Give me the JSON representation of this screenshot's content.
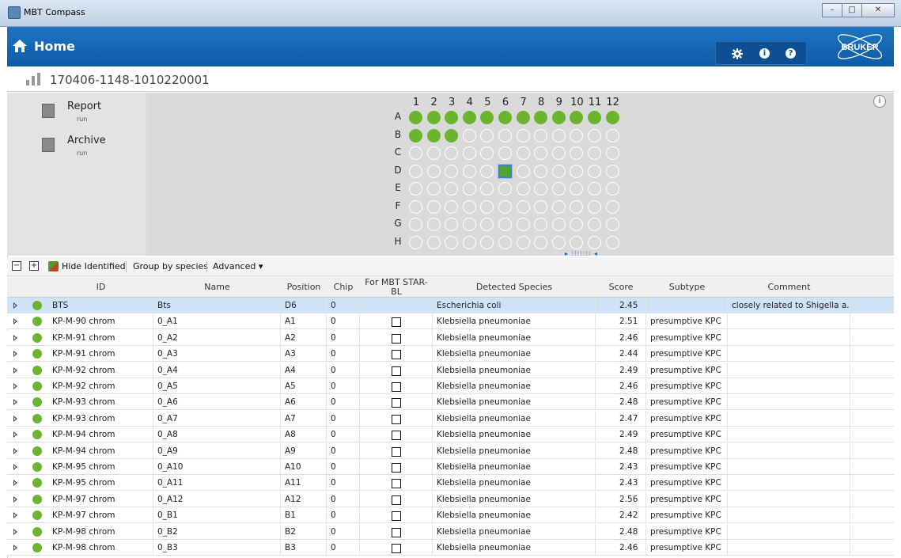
{
  "window": {
    "title": "MBT Compass",
    "controls": [
      "–",
      "□",
      "✕"
    ]
  },
  "header": {
    "home_label": "Home",
    "brand": "BRUKER"
  },
  "run": {
    "id": "170406-1148-1010220001"
  },
  "actions": [
    {
      "label": "Report",
      "sub": "run",
      "icon": "report-icon"
    },
    {
      "label": "Archive",
      "sub": "run",
      "icon": "archive-icon"
    }
  ],
  "plate": {
    "columns": [
      "1",
      "2",
      "3",
      "4",
      "5",
      "6",
      "7",
      "8",
      "9",
      "10",
      "11",
      "12"
    ],
    "rows": [
      "A",
      "B",
      "C",
      "D",
      "E",
      "F",
      "G",
      "H"
    ],
    "filled": {
      "A": [
        1,
        2,
        3,
        4,
        5,
        6,
        7,
        8,
        9,
        10,
        11,
        12
      ],
      "B": [
        1,
        2,
        3
      ]
    },
    "selected": {
      "row": "D",
      "col": 6
    },
    "info": "i",
    "scroll_indicator": "▸ ⁝⁝⁝⁝⁝⁝⁝ ◂"
  },
  "toolbar": {
    "collapse": "−",
    "expand": "+",
    "hide_identified": "Hide Identified",
    "group_by": "Group by species",
    "advanced": "Advanced ▾"
  },
  "columns": {
    "id": "ID",
    "name": "Name",
    "position": "Position",
    "chip": "Chip",
    "star": "For MBT STAR-BL",
    "species": "Detected Species",
    "score": "Score",
    "subtype": "Subtype",
    "comment": "Comment"
  },
  "rows": [
    {
      "id": "BTS",
      "name": "Bts",
      "position": "D6",
      "chip": "0",
      "species": "Escherichia coli",
      "score": "2.45",
      "subtype": "",
      "comment": "closely related to Shigella a...",
      "selected": true,
      "checkbox": false
    },
    {
      "id": "KP-M-90 chrom",
      "name": "0_A1",
      "position": "A1",
      "chip": "0",
      "species": "Klebsiella pneumoniae",
      "score": "2.51",
      "subtype": "presumptive KPC",
      "comment": "",
      "checkbox": true
    },
    {
      "id": "KP-M-91 chrom",
      "name": "0_A2",
      "position": "A2",
      "chip": "0",
      "species": "Klebsiella pneumoniae",
      "score": "2.46",
      "subtype": "presumptive KPC",
      "comment": "",
      "checkbox": true
    },
    {
      "id": "KP-M-91 chrom",
      "name": "0_A3",
      "position": "A3",
      "chip": "0",
      "species": "Klebsiella pneumoniae",
      "score": "2.44",
      "subtype": "presumptive KPC",
      "comment": "",
      "checkbox": true
    },
    {
      "id": "KP-M-92 chrom",
      "name": "0_A4",
      "position": "A4",
      "chip": "0",
      "species": "Klebsiella pneumoniae",
      "score": "2.49",
      "subtype": "presumptive KPC",
      "comment": "",
      "checkbox": true
    },
    {
      "id": "KP-M-92 chrom",
      "name": "0_A5",
      "position": "A5",
      "chip": "0",
      "species": "Klebsiella pneumoniae",
      "score": "2.46",
      "subtype": "presumptive KPC",
      "comment": "",
      "checkbox": true
    },
    {
      "id": "KP-M-93 chrom",
      "name": "0_A6",
      "position": "A6",
      "chip": "0",
      "species": "Klebsiella pneumoniae",
      "score": "2.48",
      "subtype": "presumptive KPC",
      "comment": "",
      "checkbox": true
    },
    {
      "id": "KP-M-93 chrom",
      "name": "0_A7",
      "position": "A7",
      "chip": "0",
      "species": "Klebsiella pneumoniae",
      "score": "2.47",
      "subtype": "presumptive KPC",
      "comment": "",
      "checkbox": true
    },
    {
      "id": "KP-M-94 chrom",
      "name": "0_A8",
      "position": "A8",
      "chip": "0",
      "species": "Klebsiella pneumoniae",
      "score": "2.49",
      "subtype": "presumptive KPC",
      "comment": "",
      "checkbox": true
    },
    {
      "id": "KP-M-94 chrom",
      "name": "0_A9",
      "position": "A9",
      "chip": "0",
      "species": "Klebsiella pneumoniae",
      "score": "2.48",
      "subtype": "presumptive KPC",
      "comment": "",
      "checkbox": true
    },
    {
      "id": "KP-M-95 chrom",
      "name": "0_A10",
      "position": "A10",
      "chip": "0",
      "species": "Klebsiella pneumoniae",
      "score": "2.43",
      "subtype": "presumptive KPC",
      "comment": "",
      "checkbox": true
    },
    {
      "id": "KP-M-95 chrom",
      "name": "0_A11",
      "position": "A11",
      "chip": "0",
      "species": "Klebsiella pneumoniae",
      "score": "2.43",
      "subtype": "presumptive KPC",
      "comment": "",
      "checkbox": true
    },
    {
      "id": "KP-M-97 chrom",
      "name": "0_A12",
      "position": "A12",
      "chip": "0",
      "species": "Klebsiella pneumoniae",
      "score": "2.56",
      "subtype": "presumptive KPC",
      "comment": "",
      "checkbox": true
    },
    {
      "id": "KP-M-97 chrom",
      "name": "0_B1",
      "position": "B1",
      "chip": "0",
      "species": "Klebsiella pneumoniae",
      "score": "2.42",
      "subtype": "presumptive KPC",
      "comment": "",
      "checkbox": true
    },
    {
      "id": "KP-M-98 chrom",
      "name": "0_B2",
      "position": "B2",
      "chip": "0",
      "species": "Klebsiella pneumoniae",
      "score": "2.48",
      "subtype": "presumptive KPC",
      "comment": "",
      "checkbox": true
    },
    {
      "id": "KP-M-98 chrom",
      "name": "0_B3",
      "position": "B3",
      "chip": "0",
      "species": "Klebsiella pneumoniae",
      "score": "2.46",
      "subtype": "presumptive KPC",
      "comment": "",
      "checkbox": true
    }
  ],
  "colors": {
    "accent": "#1d74c2",
    "well_green": "#6ab42e",
    "selection": "#cfe3f7"
  }
}
